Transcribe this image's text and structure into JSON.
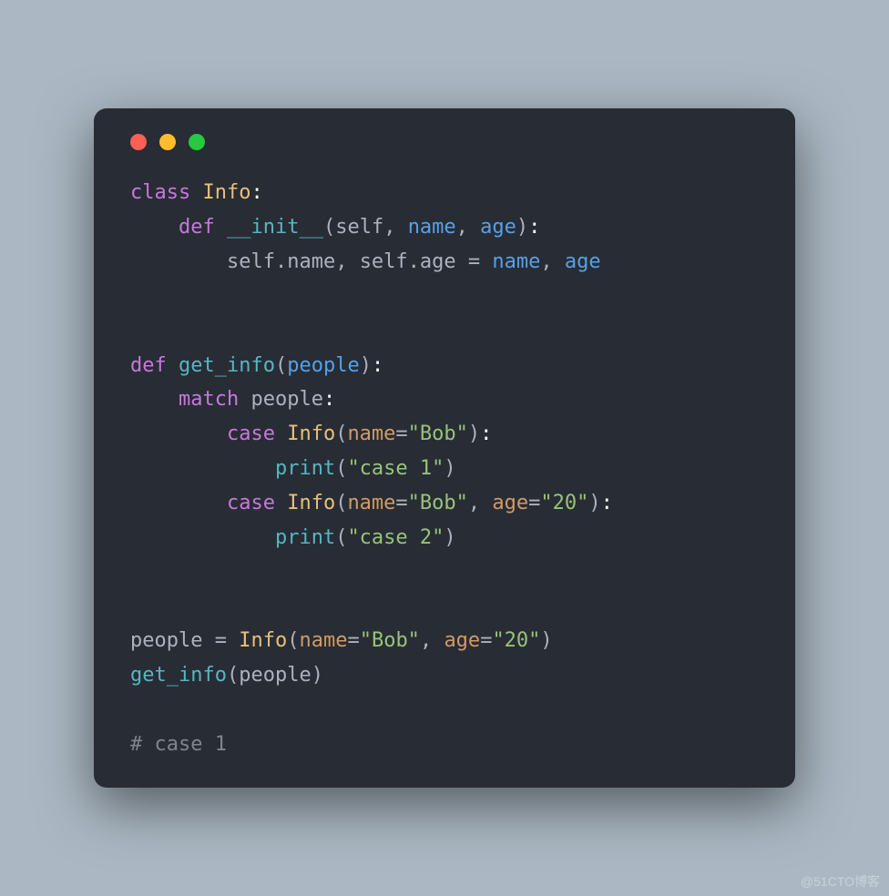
{
  "watermark": "@51CTO博客",
  "code": {
    "l1": {
      "kw": "class",
      "name": "Info",
      "colon": ":"
    },
    "l2": {
      "indent": "    ",
      "kw": "def",
      "func": "__init__",
      "open": "(",
      "p1": "self",
      "c1": ", ",
      "p2": "name",
      "c2": ", ",
      "p3": "age",
      "close": ")",
      "colon": ":"
    },
    "l3": {
      "indent": "        ",
      "s1": "self",
      "dot1": ".",
      "a1": "name",
      "c1": ", ",
      "s2": "self",
      "dot2": ".",
      "a2": "age",
      "eq": " = ",
      "r1": "name",
      "c2": ", ",
      "r2": "age"
    },
    "l4": "",
    "l5": "",
    "l6": {
      "kw": "def",
      "func": "get_info",
      "open": "(",
      "p1": "people",
      "close": ")",
      "colon": ":"
    },
    "l7": {
      "indent": "    ",
      "kw": "match",
      "arg": "people",
      "colon": ":"
    },
    "l8": {
      "indent": "        ",
      "kw": "case",
      "cls": "Info",
      "open": "(",
      "k1": "name",
      "eq1": "=",
      "s1": "\"Bob\"",
      "close": ")",
      "colon": ":"
    },
    "l9": {
      "indent": "            ",
      "func": "print",
      "open": "(",
      "s1": "\"case 1\"",
      "close": ")"
    },
    "l10": {
      "indent": "        ",
      "kw": "case",
      "cls": "Info",
      "open": "(",
      "k1": "name",
      "eq1": "=",
      "s1": "\"Bob\"",
      "c1": ", ",
      "k2": "age",
      "eq2": "=",
      "s2": "\"20\"",
      "close": ")",
      "colon": ":"
    },
    "l11": {
      "indent": "            ",
      "func": "print",
      "open": "(",
      "s1": "\"case 2\"",
      "close": ")"
    },
    "l12": "",
    "l13": "",
    "l14": {
      "var": "people",
      "eq": " = ",
      "cls": "Info",
      "open": "(",
      "k1": "name",
      "eq1": "=",
      "s1": "\"Bob\"",
      "c1": ", ",
      "k2": "age",
      "eq2": "=",
      "s2": "\"20\"",
      "close": ")"
    },
    "l15": {
      "func": "get_info",
      "open": "(",
      "p1": "people",
      "close": ")"
    },
    "l16": "",
    "l17": {
      "comment": "# case 1"
    }
  }
}
